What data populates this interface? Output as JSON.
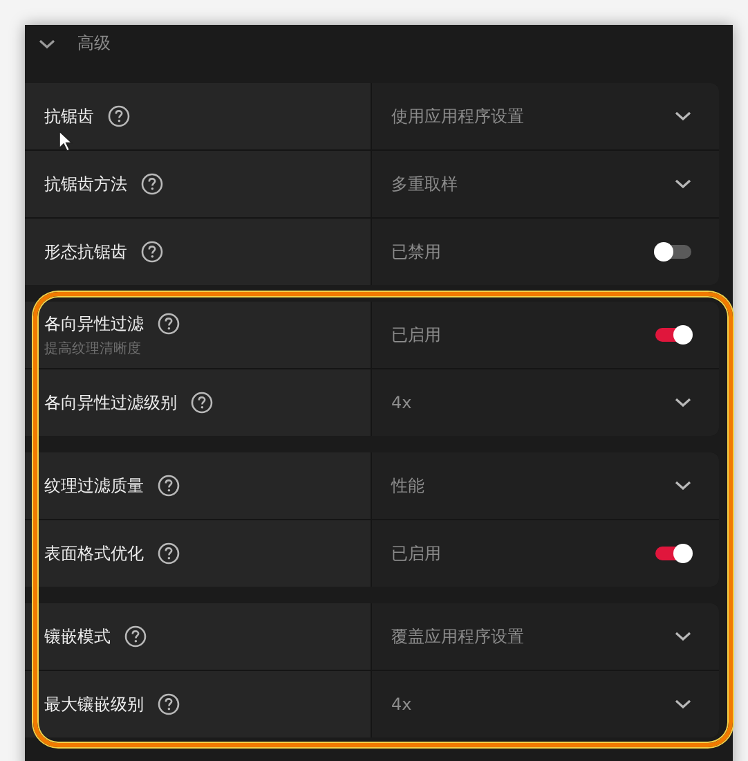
{
  "section": {
    "title": "高级",
    "expanded": true
  },
  "blocks": [
    {
      "highlighted": false,
      "groups": [
        {
          "rows": [
            {
              "label": "抗锯齿",
              "kind": "dropdown",
              "value": "使用应用程序设置"
            },
            {
              "label": "抗锯齿方法",
              "kind": "dropdown",
              "value": "多重取样"
            },
            {
              "label": "形态抗锯齿",
              "kind": "toggle",
              "value": "已禁用",
              "on": false
            }
          ]
        }
      ]
    },
    {
      "highlighted": true,
      "groups": [
        {
          "rows": [
            {
              "label": "各向异性过滤",
              "subtitle": "提高纹理清晰度",
              "kind": "toggle",
              "value": "已启用",
              "on": true
            },
            {
              "label": "各向异性过滤级别",
              "kind": "dropdown",
              "value": "4x"
            }
          ]
        },
        {
          "rows": [
            {
              "label": "纹理过滤质量",
              "kind": "dropdown",
              "value": "性能"
            },
            {
              "label": "表面格式优化",
              "kind": "toggle",
              "value": "已启用",
              "on": true
            }
          ]
        },
        {
          "rows": [
            {
              "label": "镶嵌模式",
              "kind": "dropdown",
              "value": "覆盖应用程序设置"
            },
            {
              "label": "最大镶嵌级别",
              "kind": "dropdown",
              "value": "4x"
            }
          ]
        }
      ]
    }
  ]
}
